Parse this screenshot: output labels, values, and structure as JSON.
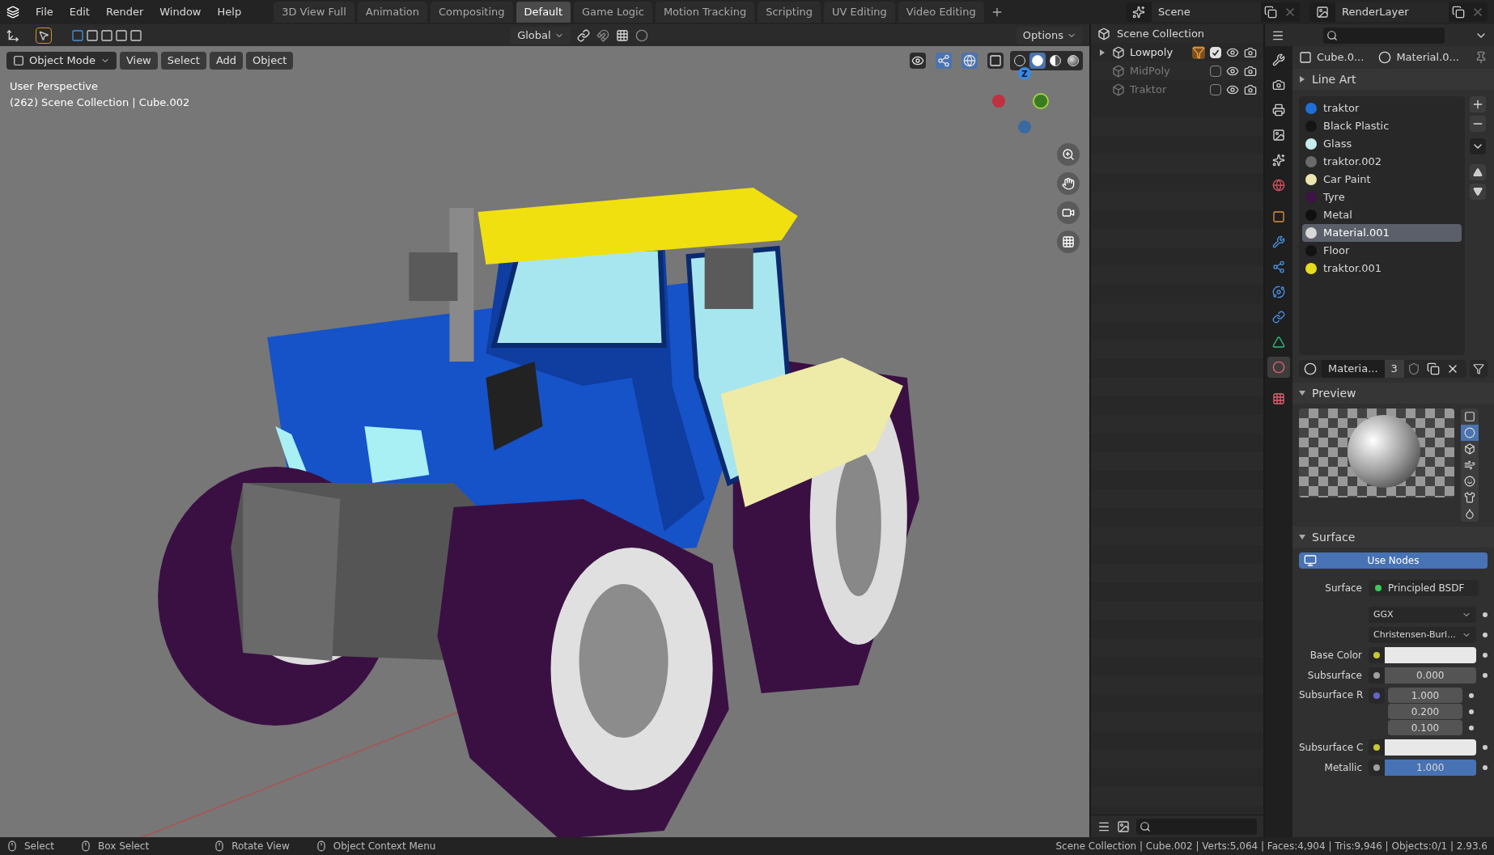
{
  "menu": [
    "File",
    "Edit",
    "Render",
    "Window",
    "Help"
  ],
  "workspaces": [
    {
      "label": "3D View Full",
      "selected": false
    },
    {
      "label": "Animation",
      "selected": false
    },
    {
      "label": "Compositing",
      "selected": false
    },
    {
      "label": "Default",
      "selected": true
    },
    {
      "label": "Game Logic",
      "selected": false
    },
    {
      "label": "Motion Tracking",
      "selected": false
    },
    {
      "label": "Scripting",
      "selected": false
    },
    {
      "label": "UV Editing",
      "selected": false
    },
    {
      "label": "Video Editing",
      "selected": false
    }
  ],
  "scene": "Scene",
  "view_layer": "RenderLayer",
  "viewport": {
    "orientation": "Global",
    "options": "Options",
    "mode": "Object Mode",
    "menus": [
      "View",
      "Select",
      "Add",
      "Object"
    ],
    "shading": [
      {
        "kind": "wireframe",
        "selected": false
      },
      {
        "kind": "solid",
        "selected": true
      },
      {
        "kind": "material",
        "selected": false
      },
      {
        "kind": "rendered",
        "selected": false
      }
    ],
    "view_name": "User Perspective",
    "info": "(262) Scene Collection | Cube.002",
    "gizmo_label": "Z"
  },
  "outliner": {
    "root": "Scene Collection",
    "items": [
      {
        "name": "Lowpoly",
        "expanded": false,
        "active": true,
        "checked": true
      },
      {
        "name": "MidPoly",
        "active": false,
        "checked": false
      },
      {
        "name": "Traktor",
        "active": false,
        "checked": false
      }
    ]
  },
  "property_tabs": [
    {
      "kind": "tool",
      "selected": false
    },
    {
      "kind": "render",
      "selected": false
    },
    {
      "kind": "output",
      "selected": false
    },
    {
      "kind": "view_layer",
      "selected": false
    },
    {
      "kind": "scene",
      "selected": false
    },
    {
      "kind": "world",
      "selected": false
    },
    {
      "kind": "object",
      "selected": false
    },
    {
      "kind": "modifier",
      "selected": false
    },
    {
      "kind": "particles",
      "selected": false
    },
    {
      "kind": "physics",
      "selected": false
    },
    {
      "kind": "constraints",
      "selected": false
    },
    {
      "kind": "data",
      "selected": false
    },
    {
      "kind": "material",
      "selected": true
    },
    {
      "kind": "texture",
      "selected": false
    }
  ],
  "properties": {
    "object": "Cube.0...",
    "material": "Material.0...",
    "line_art": {
      "title": "Line Art",
      "expanded": false
    },
    "materials": [
      {
        "name": "traktor",
        "color": "#1f6fd6",
        "selected": false
      },
      {
        "name": "Black Plastic",
        "color": "#151515",
        "selected": false
      },
      {
        "name": "Glass",
        "color": "#c6ecec",
        "selected": false
      },
      {
        "name": "traktor.002",
        "color": "#6a6a6a",
        "selected": false
      },
      {
        "name": "Car Paint",
        "color": "#ece6b0",
        "selected": false
      },
      {
        "name": "Tyre",
        "color": "#3c1446",
        "selected": false
      },
      {
        "name": "Metal",
        "color": "#101010",
        "selected": false
      },
      {
        "name": "Material.001",
        "color": "#d8d8d8",
        "selected": true
      },
      {
        "name": "Floor",
        "color": "#121212",
        "selected": false
      },
      {
        "name": "traktor.001",
        "color": "#e6dc1e",
        "selected": false
      }
    ],
    "slot": {
      "name": "Materia...",
      "users": "3"
    },
    "preview": {
      "title": "Preview",
      "expanded": true,
      "shapes": [
        {
          "kind": "flat",
          "selected": false
        },
        {
          "kind": "sphere",
          "selected": true
        },
        {
          "kind": "cube",
          "selected": false
        },
        {
          "kind": "hair",
          "selected": false
        },
        {
          "kind": "monkey",
          "selected": false
        },
        {
          "kind": "cloth",
          "selected": false
        },
        {
          "kind": "fluid",
          "selected": false
        }
      ]
    },
    "surface": {
      "title": "Surface",
      "expanded": true,
      "use_nodes": "Use Nodes",
      "rows": [
        {
          "kind": "shader",
          "label": "Surface",
          "value": "Principled BSDF",
          "color": "#3cc85a"
        },
        {
          "kind": "dropdown",
          "value": "GGX"
        },
        {
          "kind": "dropdown",
          "value": "Christensen-Burl..."
        },
        {
          "kind": "color",
          "label": "Base Color",
          "color": "#c8c832"
        },
        {
          "kind": "number",
          "label": "Subsurface",
          "value": "0.000",
          "color": "#a0a0a0"
        },
        {
          "kind": "vector",
          "label": "Subsurface R",
          "values": [
            "1.000",
            "0.200",
            "0.100"
          ],
          "color": "#6464c8"
        },
        {
          "kind": "color",
          "label": "Subsurface C",
          "color": "#c8c832"
        },
        {
          "kind": "number",
          "label": "Metallic",
          "value": "1.000",
          "level": 1,
          "color": "#a0a0a0"
        }
      ]
    }
  },
  "status_bar": {
    "hints": [
      "Select",
      "Box Select",
      "Rotate View",
      "Object Context Menu"
    ],
    "stats": "Scene Collection | Cube.002 | Verts:5,064 | Faces:4,904 | Tris:9,946 | Objects:0/1 | 2.93.6"
  }
}
